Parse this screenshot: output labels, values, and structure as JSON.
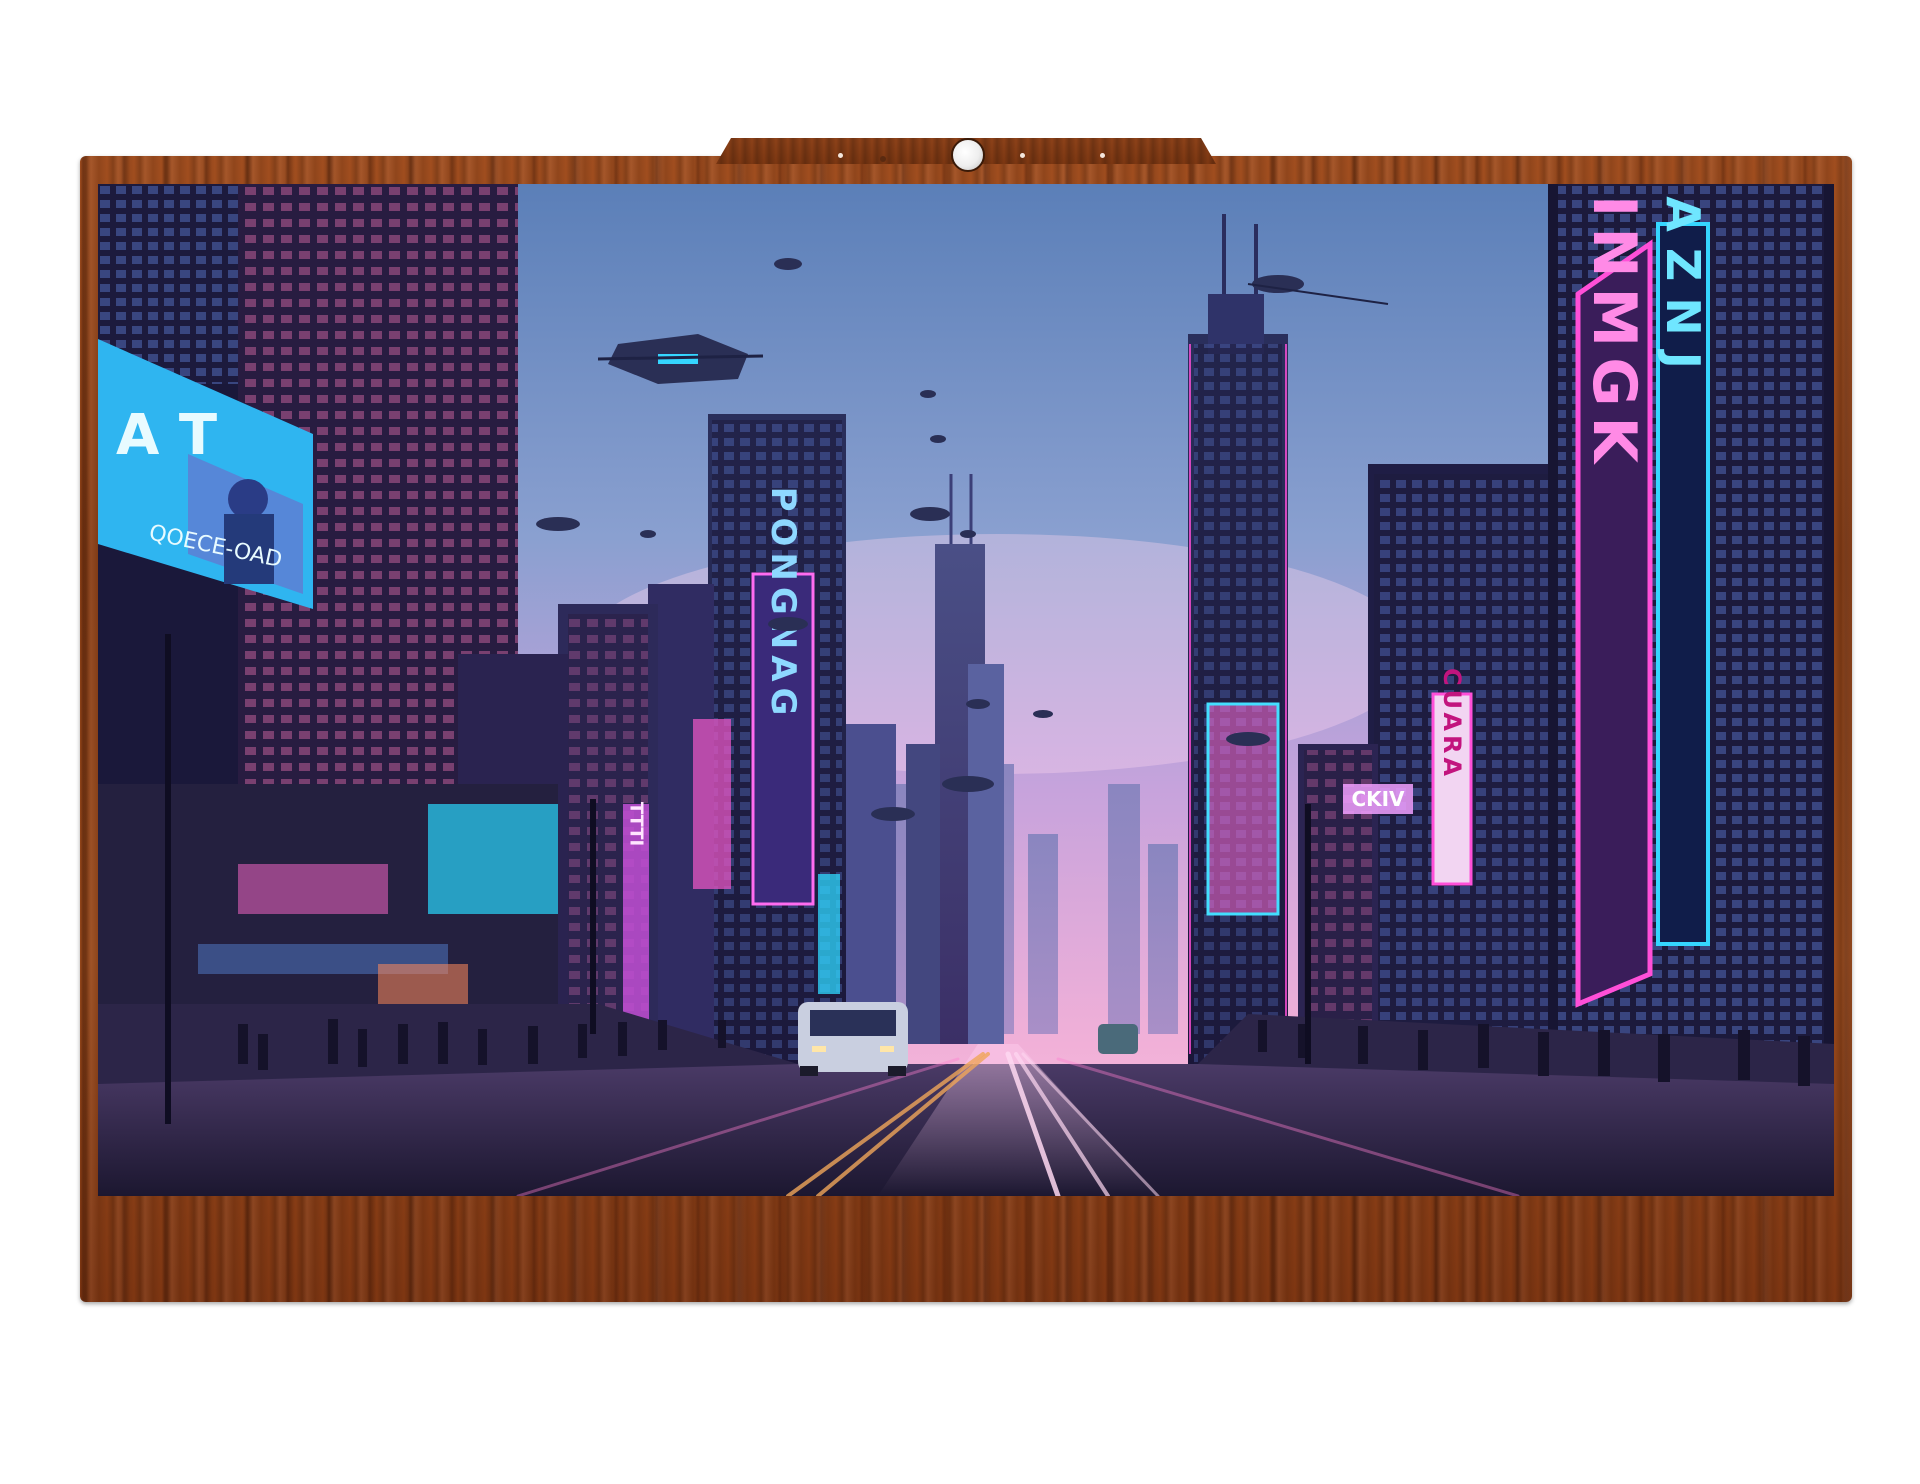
{
  "device": {
    "type": "wall monitor",
    "frame_material": "wood",
    "frame_color": "#8b3f16"
  },
  "screen": {
    "content": "cyberpunk city street wallpaper",
    "signs": {
      "billboard_left_text": "QOECE-OAD",
      "billboard_left_logo": "A T",
      "tower_sign_center": "PONGNAG",
      "tower_sign_small": "TTTI",
      "sign_right_small": "CUARA",
      "sign_right_box": "CKIV",
      "sign_right_large": "INMGK",
      "sign_right_blue": "IAZNJ"
    },
    "colors": {
      "sky_top": "#5b7fb8",
      "sky_mid": "#b59ad6",
      "sky_horizon": "#f1b0d8",
      "neon_pink": "#ff4fd8",
      "neon_cyan": "#35d6ff",
      "neon_blue": "#3a7bff",
      "street": "#2a2540"
    }
  }
}
